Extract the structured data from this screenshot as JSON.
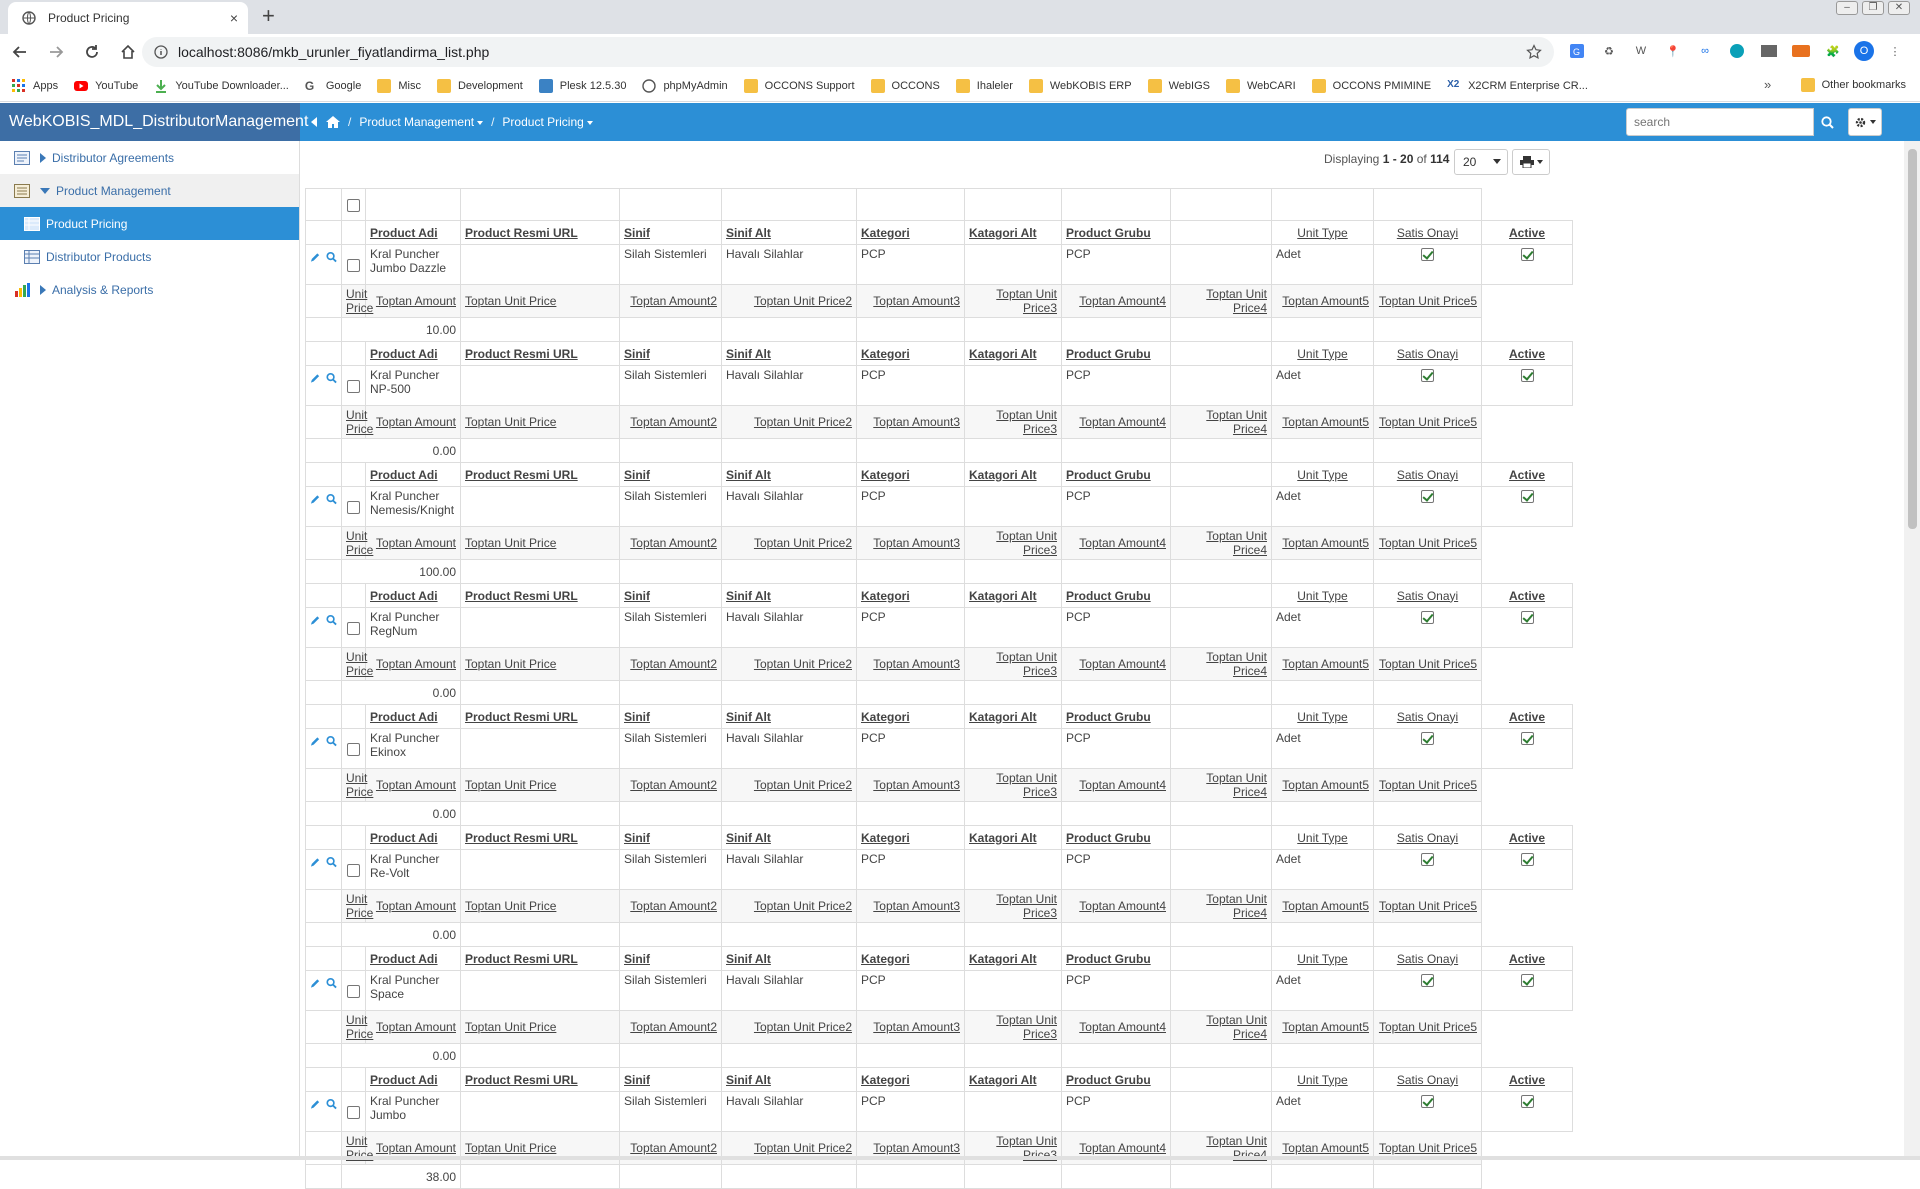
{
  "browser": {
    "tab_title": "Product Pricing",
    "url": "localhost:8086/mkb_urunler_fiyatlandirma_list.php",
    "new_tab": "+",
    "tab_close": "×",
    "avatar_letter": "O",
    "extensions": [
      "translate-icon",
      "recycle-icon",
      "w-icon",
      "pin-icon",
      "infinity-icon",
      "globe-icon",
      "html-icon",
      "ext-orange-icon",
      "puzzle-icon"
    ],
    "extension_letter_w": "W"
  },
  "bookmarks": {
    "items": [
      {
        "label": "Apps",
        "icon": "apps-grid-icon"
      },
      {
        "label": "YouTube",
        "icon": "youtube-icon"
      },
      {
        "label": "YouTube Downloader...",
        "icon": "download-icon"
      },
      {
        "label": "Google",
        "icon": "google-icon"
      },
      {
        "label": "Misc",
        "icon": "folder-icon"
      },
      {
        "label": "Development",
        "icon": "folder-icon"
      },
      {
        "label": "Plesk 12.5.30",
        "icon": "plesk-icon"
      },
      {
        "label": "phpMyAdmin",
        "icon": "globe-icon"
      },
      {
        "label": "OCCONS Support",
        "icon": "folder-icon"
      },
      {
        "label": "OCCONS",
        "icon": "folder-icon"
      },
      {
        "label": "Ihaleler",
        "icon": "folder-icon"
      },
      {
        "label": "WebKOBIS ERP",
        "icon": "folder-icon"
      },
      {
        "label": "WebIGS",
        "icon": "folder-icon"
      },
      {
        "label": "WebCARI",
        "icon": "folder-icon"
      },
      {
        "label": "OCCONS PMIMINE",
        "icon": "folder-icon"
      },
      {
        "label": "X2CRM Enterprise CR...",
        "icon": "x2-icon"
      }
    ],
    "more": "»",
    "other": "Other bookmarks"
  },
  "app": {
    "brand": "WebKOBIS_MDL_DistributorManagement",
    "breadcrumb": {
      "sep1": "/",
      "crumb1": "Product Management",
      "sep2": "/",
      "crumb2": "Product Pricing"
    },
    "search_placeholder": "search"
  },
  "sidebar": {
    "items": [
      {
        "label": "Distributor Agreements"
      },
      {
        "label": "Product Management"
      },
      {
        "label": "Product Pricing"
      },
      {
        "label": "Distributor Products"
      },
      {
        "label": "Analysis & Reports"
      }
    ]
  },
  "pager": {
    "prefix": "Displaying",
    "range": "1 - 20",
    "of": "of",
    "total": "114",
    "per_page": "20"
  },
  "grid": {
    "headers": [
      "Product Adi",
      "Product Resmi URL",
      "Sinif",
      "Sinif Alt",
      "Kategori",
      "Katagori Alt",
      "Product Grubu",
      "",
      "Unit Type",
      "Satis Onayi",
      "Active"
    ],
    "sub_headers": [
      "Unit Price",
      "Toptan Amount",
      "Toptan Unit Price",
      "Toptan Amount2",
      "Toptan Unit Price2",
      "Toptan Amount3",
      "Toptan Unit Price3",
      "Toptan Amount4",
      "Toptan Unit Price4",
      "Toptan Amount5",
      "Toptan Unit Price5"
    ],
    "rows": [
      {
        "name": "Kral Puncher Jumbo Dazzle",
        "url": "",
        "sinif": "Silah Sistemleri",
        "sinif_alt": "Havalı Silahlar",
        "kategori": "PCP",
        "katagori_alt": "",
        "grubu": "PCP",
        "unit_type": "Adet",
        "satis_onayi": true,
        "active": true,
        "unit_price": "10.00"
      },
      {
        "name": "Kral Puncher NP-500",
        "url": "",
        "sinif": "Silah Sistemleri",
        "sinif_alt": "Havalı Silahlar",
        "kategori": "PCP",
        "katagori_alt": "",
        "grubu": "PCP",
        "unit_type": "Adet",
        "satis_onayi": true,
        "active": true,
        "unit_price": "0.00"
      },
      {
        "name": "Kral Puncher Nemesis/Knight",
        "url": "",
        "sinif": "Silah Sistemleri",
        "sinif_alt": "Havalı Silahlar",
        "kategori": "PCP",
        "katagori_alt": "",
        "grubu": "PCP",
        "unit_type": "Adet",
        "satis_onayi": true,
        "active": true,
        "unit_price": "100.00"
      },
      {
        "name": "Kral Puncher RegNum",
        "url": "",
        "sinif": "Silah Sistemleri",
        "sinif_alt": "Havalı Silahlar",
        "kategori": "PCP",
        "katagori_alt": "",
        "grubu": "PCP",
        "unit_type": "Adet",
        "satis_onayi": true,
        "active": true,
        "unit_price": "0.00"
      },
      {
        "name": "Kral Puncher Ekinox",
        "url": "",
        "sinif": "Silah Sistemleri",
        "sinif_alt": "Havalı Silahlar",
        "kategori": "PCP",
        "katagori_alt": "",
        "grubu": "PCP",
        "unit_type": "Adet",
        "satis_onayi": true,
        "active": true,
        "unit_price": "0.00"
      },
      {
        "name": "Kral Puncher Re-Volt",
        "url": "",
        "sinif": "Silah Sistemleri",
        "sinif_alt": "Havalı Silahlar",
        "kategori": "PCP",
        "katagori_alt": "",
        "grubu": "PCP",
        "unit_type": "Adet",
        "satis_onayi": true,
        "active": true,
        "unit_price": "0.00"
      },
      {
        "name": "Kral Puncher Space",
        "url": "",
        "sinif": "Silah Sistemleri",
        "sinif_alt": "Havalı Silahlar",
        "kategori": "PCP",
        "katagori_alt": "",
        "grubu": "PCP",
        "unit_type": "Adet",
        "satis_onayi": true,
        "active": true,
        "unit_price": "0.00"
      },
      {
        "name": "Kral Puncher Jumbo",
        "url": "",
        "sinif": "Silah Sistemleri",
        "sinif_alt": "Havalı Silahlar",
        "kategori": "PCP",
        "katagori_alt": "",
        "grubu": "PCP",
        "unit_type": "Adet",
        "satis_onayi": true,
        "active": true,
        "unit_price": "38.00"
      }
    ]
  },
  "colors": {
    "header_blue": "#2c8fd6",
    "brand_blue": "#3d6ea5",
    "link_blue": "#3a6ea8"
  }
}
